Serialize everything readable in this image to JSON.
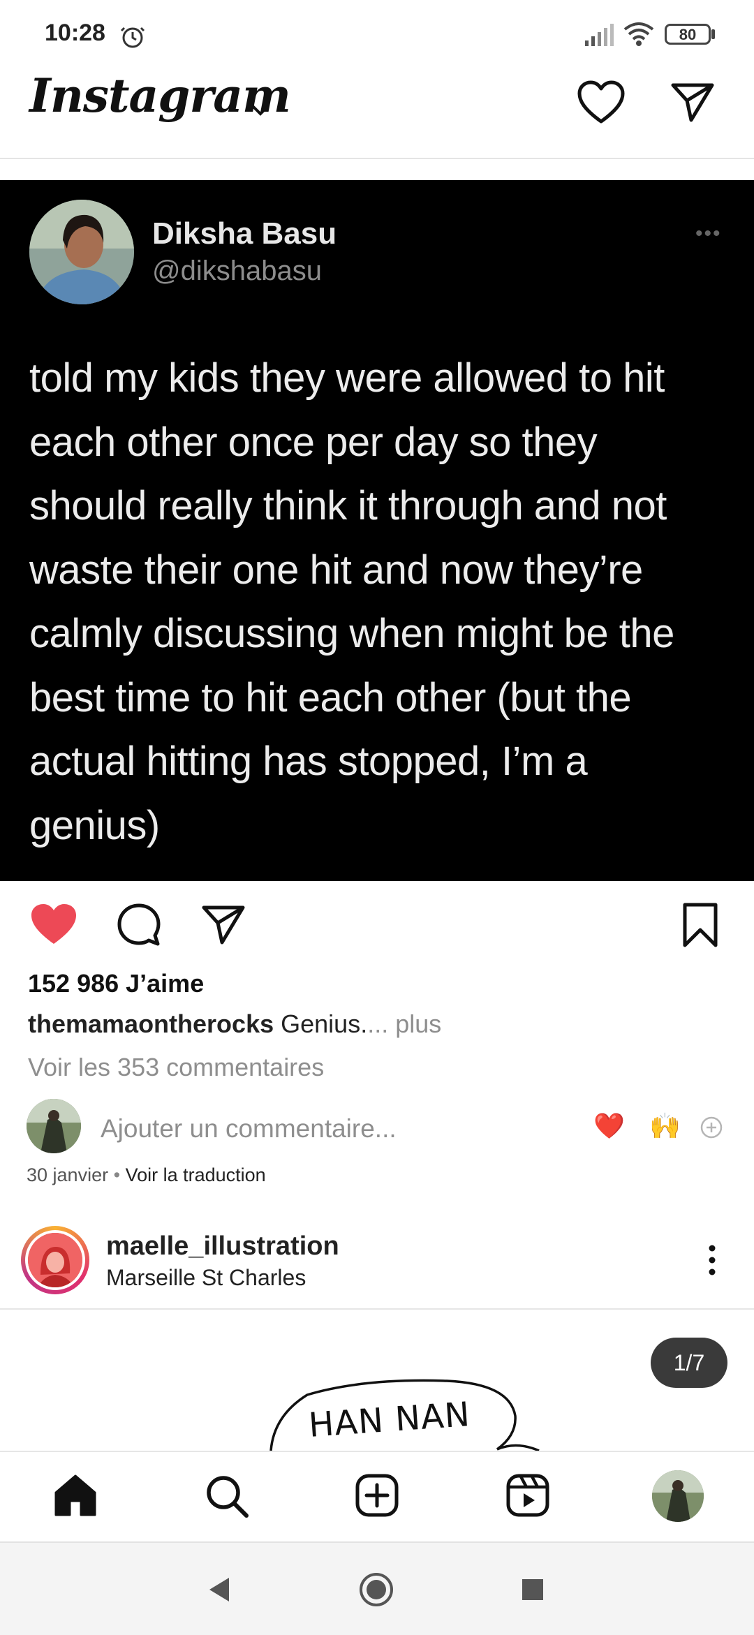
{
  "status_bar": {
    "time": "10:28",
    "battery": "80",
    "icons": [
      "alarm-icon",
      "signal-icon",
      "wifi-icon",
      "battery-icon"
    ]
  },
  "header": {
    "logo": "Instagram",
    "icons": [
      "chevron-down-icon",
      "heart-icon",
      "direct-message-icon"
    ]
  },
  "tweet": {
    "name": "Diksha Basu",
    "handle": "@dikshabasu",
    "more": "•••",
    "lines": [
      "told my kids they were allowed to hit",
      "each other once per day so they",
      "should really think it through and not",
      "waste their one hit and now they’re",
      "calmly discussing when might be the",
      "best time to hit each other (but the",
      "actual hitting has stopped, I’m a",
      "genius)"
    ]
  },
  "post": {
    "likes": "152 986 J’aime",
    "caption_user": "themamaontherocks",
    "caption_text": "Genius.",
    "caption_more": "... plus",
    "comments_link": "Voir les 353 commentaires",
    "comment_placeholder": "Ajouter un commentaire...",
    "quick_reactions": [
      "❤️",
      "🙌"
    ],
    "date": "30 janvier",
    "date_separator": "•",
    "translate": "Voir la traduction",
    "liked": true,
    "accent_like": "#ed4956"
  },
  "next_post": {
    "username": "maelle_illustration",
    "location": "Marseille St Charles",
    "counter": "1/7",
    "drawing_text": "HAN NAN"
  },
  "bottom_nav": {
    "items": [
      "home-icon",
      "search-icon",
      "create-post-icon",
      "reels-icon",
      "profile-avatar"
    ]
  },
  "system_nav": {
    "items": [
      "back-icon",
      "home-circle-icon",
      "recents-icon"
    ]
  }
}
